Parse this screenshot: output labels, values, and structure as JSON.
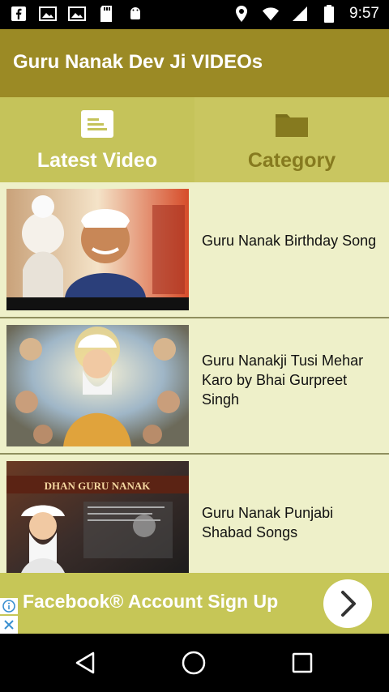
{
  "status_bar": {
    "time": "9:57",
    "left_icons": [
      "facebook-icon",
      "image-icon",
      "image-icon",
      "sd-card-icon",
      "android-icon"
    ],
    "right_icons": [
      "location-icon",
      "wifi-icon",
      "signal-icon",
      "battery-icon"
    ]
  },
  "app_bar": {
    "title": "Guru Nanak Dev Ji VIDEOs"
  },
  "tabs": [
    {
      "label": "Latest Video",
      "icon": "document-icon",
      "active": true
    },
    {
      "label": "Category",
      "icon": "folder-icon",
      "active": false
    }
  ],
  "videos": [
    {
      "title": "Guru Nanak Birthday Song"
    },
    {
      "title": "Guru Nanakji Tusi Mehar Karo by Bhai Gurpreet Singh"
    },
    {
      "title": "Guru Nanak Punjabi Shabad Songs"
    }
  ],
  "thumbnail_texts": [
    "DHAN GURU NANAK"
  ],
  "ad": {
    "text": "Facebook® Account Sign Up",
    "icons": [
      "info-icon",
      "close-icon",
      "chevron-right-icon"
    ]
  },
  "nav": {
    "icons": [
      "back-icon",
      "home-icon",
      "recents-icon"
    ]
  },
  "colors": {
    "app_bar": "#9b8a25",
    "tab_bg": "#c5c35a",
    "list_bg": "#eef0c9",
    "ad_bg": "#c6c657"
  }
}
